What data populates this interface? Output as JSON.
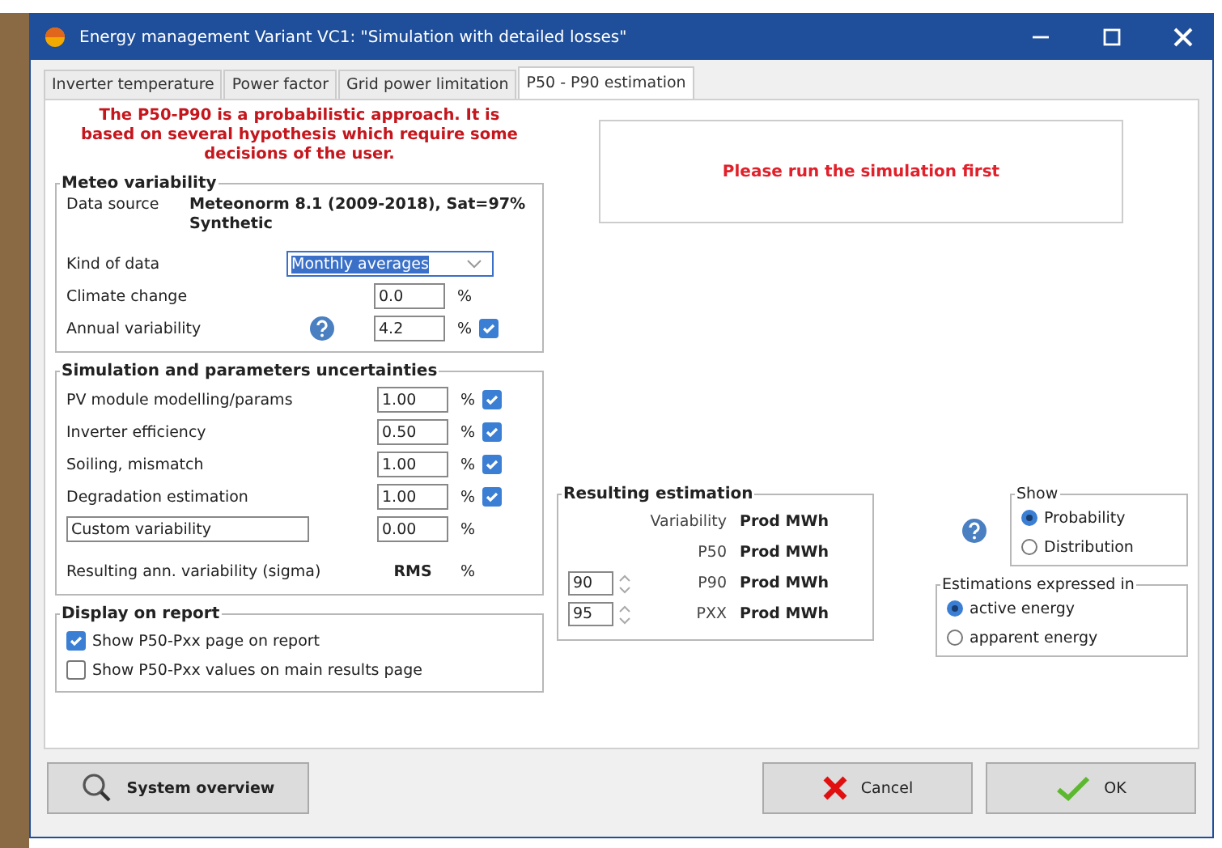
{
  "window": {
    "title": "Energy management Variant VC1:  \"Simulation with detailed losses\""
  },
  "tabs": [
    {
      "label": "Inverter temperature",
      "selected": false
    },
    {
      "label": "Power factor",
      "selected": false
    },
    {
      "label": "Grid power limitation",
      "selected": false
    },
    {
      "label": "P50 - P90 estimation",
      "selected": true
    }
  ],
  "intro_note": "The P50-P90 is a probabilistic approach. It is based on several hypothesis which require some decisions of the user.",
  "meteo_variability": {
    "title": "Meteo variability",
    "data_source_label": "Data source",
    "data_source_lines": [
      "Meteonorm 8.1 (2009-2018), Sat=97%",
      "Synthetic"
    ],
    "kind_of_data_label": "Kind of data",
    "kind_of_data_value": "Monthly averages",
    "rows": [
      {
        "label": "Climate change",
        "value": "0.0",
        "unit": "%",
        "help": false
      },
      {
        "label": "Annual variability",
        "value": "4.2",
        "unit": "%",
        "help": true,
        "checked": true
      }
    ]
  },
  "uncertainties": {
    "title": "Simulation and parameters uncertainties",
    "rows": [
      {
        "kind": "fixed",
        "label": "PV module modelling/params",
        "value": "1.00",
        "unit": "%",
        "checked": true
      },
      {
        "kind": "fixed",
        "label": "Inverter efficiency",
        "value": "0.50",
        "unit": "%",
        "checked": true
      },
      {
        "kind": "fixed",
        "label": "Soiling, mismatch",
        "value": "1.00",
        "unit": "%",
        "checked": true
      },
      {
        "kind": "fixed",
        "label": "Degradation estimation",
        "value": "1.00",
        "unit": "%",
        "checked": true
      },
      {
        "kind": "custom",
        "label": "Custom variability",
        "value": "0.00",
        "unit": "%"
      }
    ],
    "result_label": "Resulting ann. variability (sigma)",
    "result_value": "RMS",
    "result_unit": "%"
  },
  "display_on_report": {
    "title": "Display on report",
    "options": [
      {
        "label": "Show P50-Pxx page on report",
        "checked": true
      },
      {
        "label": "Show P50-Pxx values on main results page",
        "checked": false
      }
    ]
  },
  "message": "Please run the simulation first",
  "resulting_estimation": {
    "title": "Resulting estimation",
    "rows": [
      {
        "label": "Variability",
        "value": "Prod MWh"
      },
      {
        "label": "P50",
        "value": "Prod MWh"
      },
      {
        "spinner": "90",
        "label": "P90",
        "value": "Prod MWh"
      },
      {
        "spinner": "95",
        "label": "PXX",
        "value": "Prod MWh"
      }
    ]
  },
  "show": {
    "title": "Show",
    "options": [
      {
        "label": "Probability",
        "selected": true
      },
      {
        "label": "Distribution",
        "selected": false
      }
    ]
  },
  "estimations_expressed_in": {
    "title": "Estimations expressed in",
    "options": [
      {
        "label": "active energy",
        "selected": true
      },
      {
        "label": "apparent energy",
        "selected": false
      }
    ]
  },
  "buttons": [
    {
      "kind": "overview",
      "label": "System overview"
    },
    {
      "kind": "cancel",
      "label": "Cancel"
    },
    {
      "kind": "ok",
      "label": "OK"
    }
  ]
}
